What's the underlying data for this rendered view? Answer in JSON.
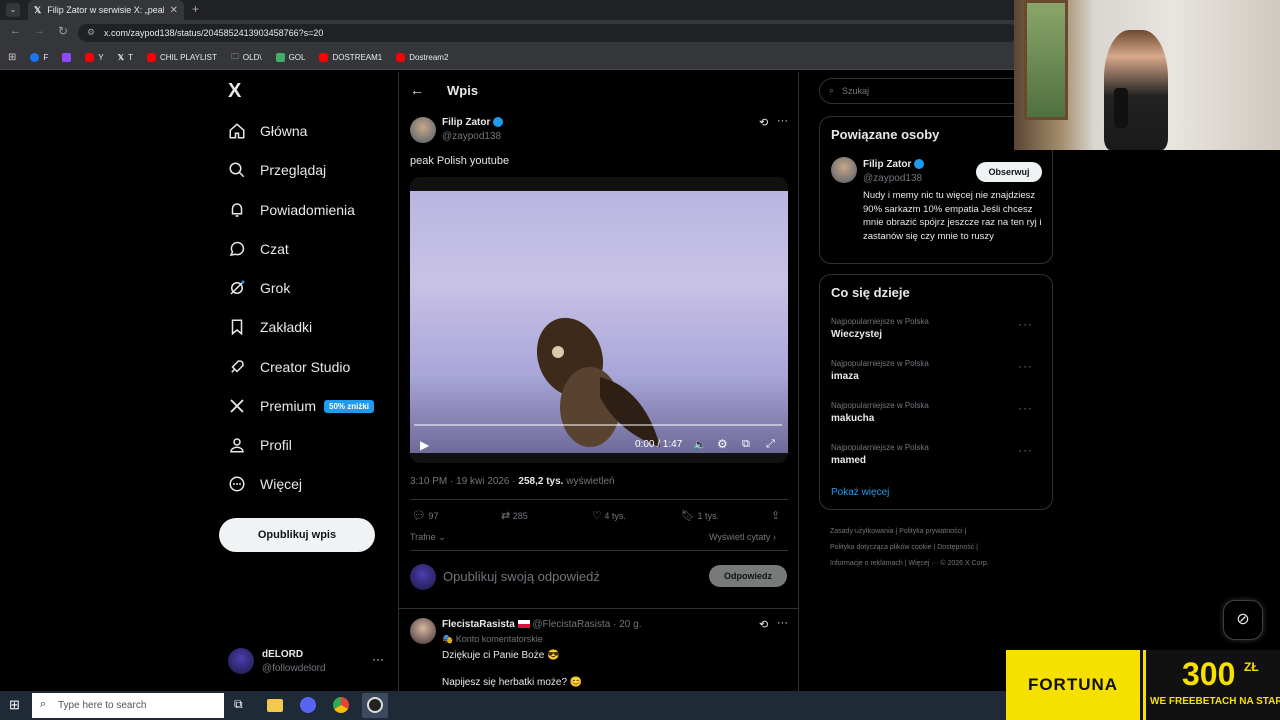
{
  "browser": {
    "tab_title": "Filip Zator w serwisie X: „peak P",
    "url": "x.com/zaypod138/status/2045852413903458766?s=20",
    "bookmarks": [
      "F",
      "Y",
      "T",
      "CHIL PLAYLIST",
      "OLD\\",
      "GOL",
      "DOSTREAM1",
      "Dostream2"
    ]
  },
  "nav": {
    "logo": "X",
    "items": [
      "Główna",
      "Przeglądaj",
      "Powiadomienia",
      "Czat",
      "Grok",
      "Zakładki",
      "Creator Studio",
      "Premium",
      "Profil",
      "Więcej"
    ],
    "premium_badge": "50% zniżki",
    "post_button": "Opublikuj wpis",
    "account_name": "dELORD",
    "account_handle": "@followdelord"
  },
  "post": {
    "header_title": "Wpis",
    "author_name": "Filip Zator",
    "author_handle": "@zaypod138",
    "text": "peak Polish youtube",
    "video_time": "0:00 / 1:47",
    "video_progress": 0,
    "timestamp": "3:10 PM · 19 kwi 2026 ·",
    "views_count": "258,2 tys.",
    "views_label": "wyświetleń",
    "replies": "97",
    "reposts": "285",
    "likes": "4 tys.",
    "bookmarks": "1 tys.",
    "sort_label": "Trafne",
    "quotes_link": "Wyświetl cytaty",
    "reply_placeholder": "Opublikuj swoją odpowiedź",
    "reply_button": "Odpowiedz"
  },
  "reply": {
    "name": "FlecistaRasista",
    "handle": "@FlecistaRasista · 20 g.",
    "account_type": "Konto komentatorskie",
    "line1": "Dziękuje ci Panie Boże 😎",
    "line2": "Napijesz się herbatki może? 😊"
  },
  "sidebar": {
    "search_placeholder": "Szukaj",
    "related_title": "Powiązane osoby",
    "related_name": "Filip Zator",
    "related_handle": "@zaypod138",
    "follow_button": "Obserwuj",
    "bio": "Nudy i memy nic tu więcej nie znajdziesz 90% sarkazm 10% empatia Jeśli chcesz mnie obrazić spójrz jeszcze raz na ten ryj i zastanów się czy mnie to ruszy",
    "trends_title": "Co się dzieje",
    "trends": [
      {
        "category": "Najpopularniejsze w Polska",
        "name": "Wieczystej"
      },
      {
        "category": "Najpopularniejsze w Polska",
        "name": "imaza"
      },
      {
        "category": "Najpopularniejsze w Polska",
        "name": "makucha"
      },
      {
        "category": "Najpopularniejsze w Polska",
        "name": "mamed"
      }
    ],
    "show_more": "Pokaż więcej",
    "footer1": "Zasady użytkowania  |  Polityka prywatności  |",
    "footer2": "Polityka dotycząca plików cookie  |  Dostępność  |",
    "footer3": "Informacje o reklamach  |  Więcej ···  © 2026 X Corp."
  },
  "ad": {
    "brand": "FORTUNA",
    "amount": "300",
    "currency": "ZŁ",
    "tagline": "WE FREEBETACH NA START"
  },
  "taskbar": {
    "search_placeholder": "Type here to search"
  },
  "colors": {
    "accent": "#1d9bf0",
    "background": "#000000",
    "ad_yellow": "#f5e000"
  }
}
